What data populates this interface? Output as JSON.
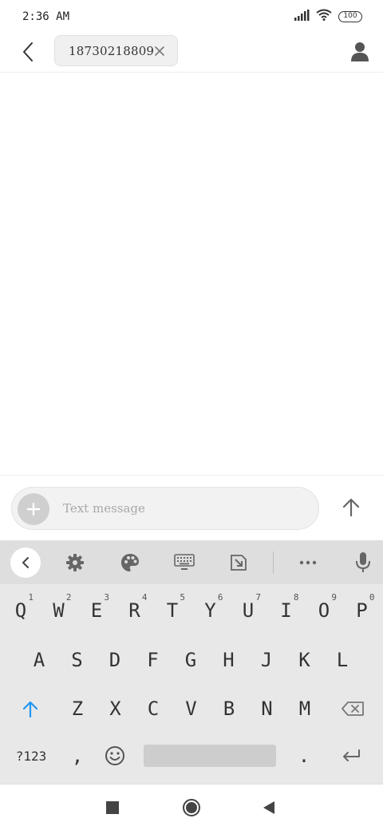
{
  "status_bar": {
    "time": "2:36 AM",
    "battery": "100"
  },
  "header": {
    "recipient": "18730218809"
  },
  "composer": {
    "placeholder": "Text message"
  },
  "keyboard": {
    "row1": [
      {
        "label": "Q",
        "hint": "1"
      },
      {
        "label": "W",
        "hint": "2"
      },
      {
        "label": "E",
        "hint": "3"
      },
      {
        "label": "R",
        "hint": "4"
      },
      {
        "label": "T",
        "hint": "5"
      },
      {
        "label": "Y",
        "hint": "6"
      },
      {
        "label": "U",
        "hint": "7"
      },
      {
        "label": "I",
        "hint": "8"
      },
      {
        "label": "O",
        "hint": "9"
      },
      {
        "label": "P",
        "hint": "0"
      }
    ],
    "row2": [
      "A",
      "S",
      "D",
      "F",
      "G",
      "H",
      "J",
      "K",
      "L"
    ],
    "row3": [
      "Z",
      "X",
      "C",
      "V",
      "B",
      "N",
      "M"
    ],
    "symbols_label": "?123",
    "comma": ",",
    "period": ".",
    "colors": {
      "shift_accent": "#2196f3"
    }
  }
}
